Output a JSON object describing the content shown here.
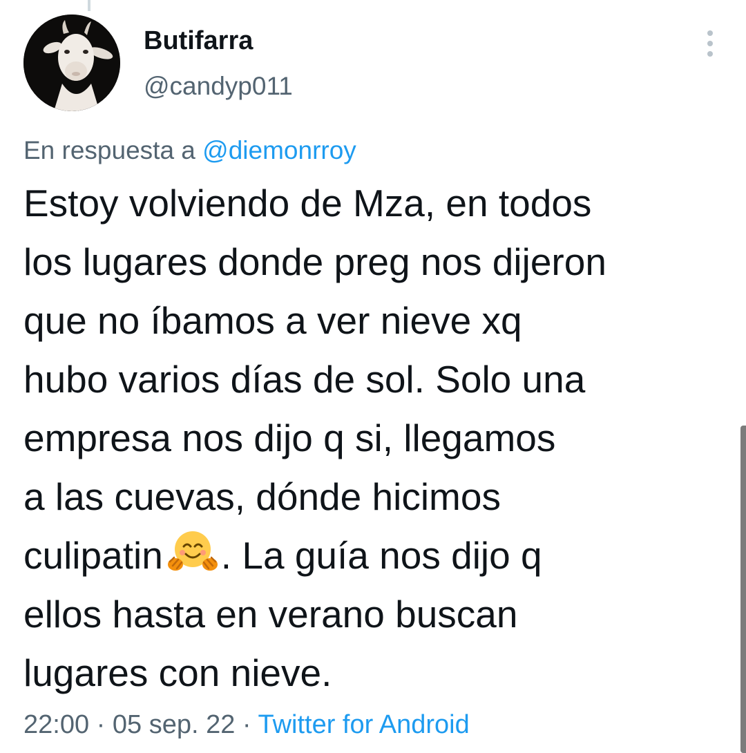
{
  "tweet": {
    "author": {
      "name": "Butifarra",
      "handle": "@candyp011",
      "avatar_icon": "goat-avatar"
    },
    "more_icon": "more-vertical-icon",
    "reply_context": {
      "prefix": "En respuesta a",
      "mention": "@diemonrroy"
    },
    "text_lines": [
      "Estoy volviendo de Mza, en todos",
      "los lugares donde preg nos dijeron",
      "que no íbamos a ver nieve xq",
      "hubo varios días de sol. Solo una",
      "empresa nos dijo q si, llegamos",
      "a las cuevas, dónde hicimos",
      "culipatin",
      ". La guía nos dijo q",
      "ellos hasta en verano buscan",
      "lugares con nieve."
    ],
    "emoji": "hugging-face-emoji",
    "time": "22:00",
    "date": "05 sep. 22",
    "separator": "·",
    "source": "Twitter for Android"
  },
  "colors": {
    "text": "#0f1419",
    "secondary": "#536471",
    "link": "#1d9bf0",
    "background": "#ffffff"
  }
}
